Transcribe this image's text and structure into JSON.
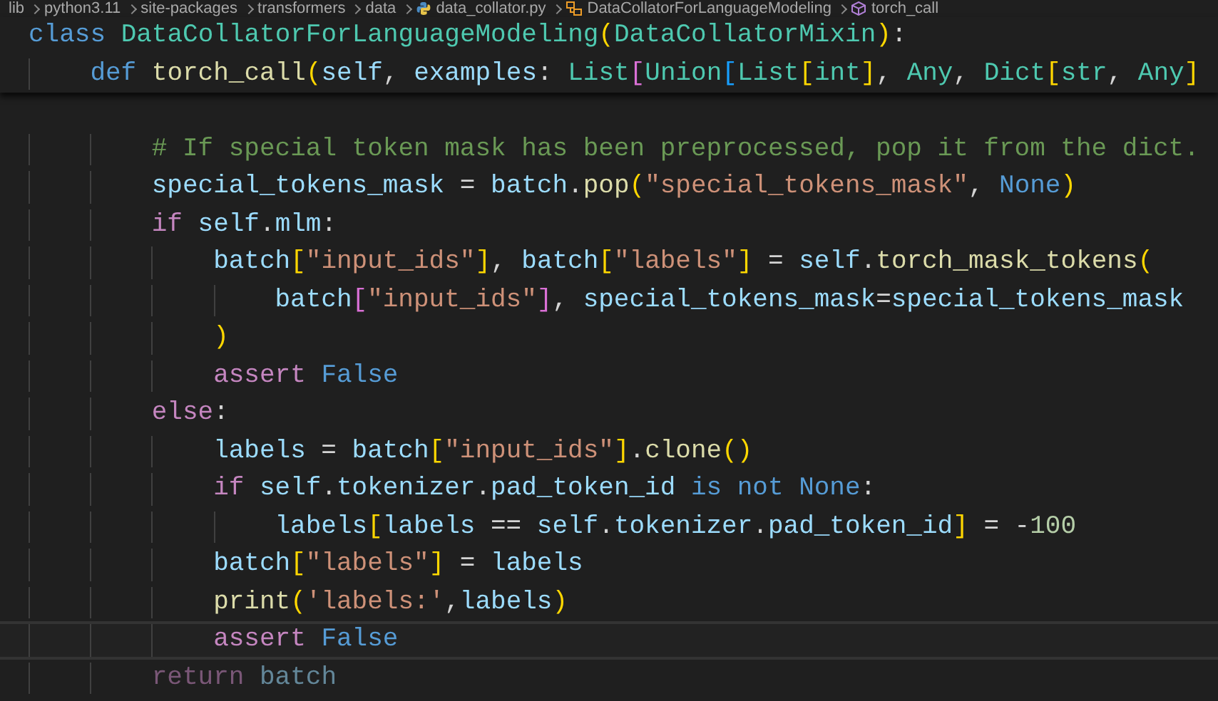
{
  "breadcrumb": [
    {
      "label": "lib",
      "kind": "folder"
    },
    {
      "label": "python3.11",
      "kind": "folder"
    },
    {
      "label": "site-packages",
      "kind": "folder"
    },
    {
      "label": "transformers",
      "kind": "folder"
    },
    {
      "label": "data",
      "kind": "folder"
    },
    {
      "label": "data_collator.py",
      "kind": "file"
    },
    {
      "label": "DataCollatorForLanguageModeling",
      "kind": "class"
    },
    {
      "label": "torch_call",
      "kind": "method"
    }
  ],
  "sticky_lines": [
    {
      "current": false,
      "dimmed": false,
      "tokens": [
        {
          "text": "class ",
          "kind": "kw"
        },
        {
          "text": "DataCollatorForLanguageModeling",
          "kind": "cls"
        },
        {
          "text": "(",
          "kind": "b1"
        },
        {
          "text": "DataCollatorMixin",
          "kind": "cls"
        },
        {
          "text": ")",
          "kind": "b1"
        },
        {
          "text": ":",
          "kind": "p"
        }
      ],
      "children": [
        {
          "current": false,
          "dimmed": false,
          "tokens": [
            {
              "text": "def ",
              "kind": "kw"
            },
            {
              "text": "torch_call",
              "kind": "fn"
            },
            {
              "text": "(",
              "kind": "b1"
            },
            {
              "text": "self",
              "kind": "var"
            },
            {
              "text": ", ",
              "kind": "p"
            },
            {
              "text": "examples",
              "kind": "var"
            },
            {
              "text": ": ",
              "kind": "p"
            },
            {
              "text": "List",
              "kind": "cls"
            },
            {
              "text": "[",
              "kind": "b2"
            },
            {
              "text": "Union",
              "kind": "cls"
            },
            {
              "text": "[",
              "kind": "b3"
            },
            {
              "text": "List",
              "kind": "cls"
            },
            {
              "text": "[",
              "kind": "b1"
            },
            {
              "text": "int",
              "kind": "cls"
            },
            {
              "text": "]",
              "kind": "b1"
            },
            {
              "text": ", ",
              "kind": "p"
            },
            {
              "text": "Any",
              "kind": "cls"
            },
            {
              "text": ", ",
              "kind": "p"
            },
            {
              "text": "Dict",
              "kind": "cls"
            },
            {
              "text": "[",
              "kind": "b1"
            },
            {
              "text": "str",
              "kind": "cls"
            },
            {
              "text": ", ",
              "kind": "p"
            },
            {
              "text": "Any",
              "kind": "cls"
            },
            {
              "text": "]",
              "kind": "b1"
            }
          ]
        }
      ]
    }
  ],
  "code_lines": [
    {
      "current": false,
      "dimmed": false,
      "tokens": [
        {
          "text": "# If special token mask has been preprocessed, pop it from the dict.",
          "kind": "cmt"
        }
      ]
    },
    {
      "current": false,
      "dimmed": false,
      "tokens": [
        {
          "text": "special_tokens_mask",
          "kind": "var"
        },
        {
          "text": " = ",
          "kind": "p"
        },
        {
          "text": "batch",
          "kind": "var"
        },
        {
          "text": ".",
          "kind": "p"
        },
        {
          "text": "pop",
          "kind": "fn"
        },
        {
          "text": "(",
          "kind": "b1"
        },
        {
          "text": "\"special_tokens_mask\"",
          "kind": "str"
        },
        {
          "text": ", ",
          "kind": "p"
        },
        {
          "text": "None",
          "kind": "kw"
        },
        {
          "text": ")",
          "kind": "b1"
        }
      ]
    },
    {
      "current": false,
      "dimmed": false,
      "tokens": [
        {
          "text": "if ",
          "kind": "ctl"
        },
        {
          "text": "self",
          "kind": "var"
        },
        {
          "text": ".",
          "kind": "p"
        },
        {
          "text": "mlm",
          "kind": "var"
        },
        {
          "text": ":",
          "kind": "p"
        }
      ],
      "children": [
        {
          "current": false,
          "dimmed": false,
          "tokens": [
            {
              "text": "batch",
              "kind": "var"
            },
            {
              "text": "[",
              "kind": "b1"
            },
            {
              "text": "\"input_ids\"",
              "kind": "str"
            },
            {
              "text": "]",
              "kind": "b1"
            },
            {
              "text": ", ",
              "kind": "p"
            },
            {
              "text": "batch",
              "kind": "var"
            },
            {
              "text": "[",
              "kind": "b1"
            },
            {
              "text": "\"labels\"",
              "kind": "str"
            },
            {
              "text": "]",
              "kind": "b1"
            },
            {
              "text": " = ",
              "kind": "p"
            },
            {
              "text": "self",
              "kind": "var"
            },
            {
              "text": ".",
              "kind": "p"
            },
            {
              "text": "torch_mask_tokens",
              "kind": "fn"
            },
            {
              "text": "(",
              "kind": "b1"
            }
          ],
          "children": [
            {
              "current": false,
              "dimmed": false,
              "tokens": [
                {
                  "text": "batch",
                  "kind": "var"
                },
                {
                  "text": "[",
                  "kind": "b2"
                },
                {
                  "text": "\"input_ids\"",
                  "kind": "str"
                },
                {
                  "text": "]",
                  "kind": "b2"
                },
                {
                  "text": ", ",
                  "kind": "p"
                },
                {
                  "text": "special_tokens_mask",
                  "kind": "var"
                },
                {
                  "text": "=",
                  "kind": "p"
                },
                {
                  "text": "special_tokens_mask",
                  "kind": "var"
                }
              ]
            }
          ]
        },
        {
          "current": false,
          "dimmed": false,
          "tokens": [
            {
              "text": ")",
              "kind": "b1"
            }
          ]
        },
        {
          "current": false,
          "dimmed": false,
          "tokens": [
            {
              "text": "assert ",
              "kind": "ctl"
            },
            {
              "text": "False",
              "kind": "kw"
            }
          ]
        }
      ]
    },
    {
      "current": false,
      "dimmed": false,
      "tokens": [
        {
          "text": "else",
          "kind": "ctl"
        },
        {
          "text": ":",
          "kind": "p"
        }
      ],
      "children": [
        {
          "current": false,
          "dimmed": false,
          "tokens": [
            {
              "text": "labels",
              "kind": "var"
            },
            {
              "text": " = ",
              "kind": "p"
            },
            {
              "text": "batch",
              "kind": "var"
            },
            {
              "text": "[",
              "kind": "b1"
            },
            {
              "text": "\"input_ids\"",
              "kind": "str"
            },
            {
              "text": "]",
              "kind": "b1"
            },
            {
              "text": ".",
              "kind": "p"
            },
            {
              "text": "clone",
              "kind": "fn"
            },
            {
              "text": "()",
              "kind": "b1"
            }
          ]
        },
        {
          "current": false,
          "dimmed": false,
          "tokens": [
            {
              "text": "if ",
              "kind": "ctl"
            },
            {
              "text": "self",
              "kind": "var"
            },
            {
              "text": ".",
              "kind": "p"
            },
            {
              "text": "tokenizer",
              "kind": "var"
            },
            {
              "text": ".",
              "kind": "p"
            },
            {
              "text": "pad_token_id ",
              "kind": "var"
            },
            {
              "text": "is not None",
              "kind": "kw"
            },
            {
              "text": ":",
              "kind": "p"
            }
          ],
          "children": [
            {
              "current": false,
              "dimmed": false,
              "tokens": [
                {
                  "text": "labels",
                  "kind": "var"
                },
                {
                  "text": "[",
                  "kind": "b1"
                },
                {
                  "text": "labels",
                  "kind": "var"
                },
                {
                  "text": " == ",
                  "kind": "p"
                },
                {
                  "text": "self",
                  "kind": "var"
                },
                {
                  "text": ".",
                  "kind": "p"
                },
                {
                  "text": "tokenizer",
                  "kind": "var"
                },
                {
                  "text": ".",
                  "kind": "p"
                },
                {
                  "text": "pad_token_id",
                  "kind": "var"
                },
                {
                  "text": "]",
                  "kind": "b1"
                },
                {
                  "text": " = -",
                  "kind": "p"
                },
                {
                  "text": "100",
                  "kind": "num"
                }
              ]
            }
          ]
        },
        {
          "current": false,
          "dimmed": false,
          "tokens": [
            {
              "text": "batch",
              "kind": "var"
            },
            {
              "text": "[",
              "kind": "b1"
            },
            {
              "text": "\"labels\"",
              "kind": "str"
            },
            {
              "text": "]",
              "kind": "b1"
            },
            {
              "text": " = ",
              "kind": "p"
            },
            {
              "text": "labels",
              "kind": "var"
            }
          ]
        },
        {
          "current": false,
          "dimmed": false,
          "tokens": [
            {
              "text": "print",
              "kind": "fn"
            },
            {
              "text": "(",
              "kind": "b1"
            },
            {
              "text": "'labels:'",
              "kind": "str"
            },
            {
              "text": ",",
              "kind": "p"
            },
            {
              "text": "labels",
              "kind": "var"
            },
            {
              "text": ")",
              "kind": "b1"
            }
          ]
        },
        {
          "current": true,
          "dimmed": false,
          "tokens": [
            {
              "text": "assert ",
              "kind": "ctl"
            },
            {
              "text": "False",
              "kind": "kw"
            }
          ]
        }
      ]
    },
    {
      "current": false,
      "dimmed": true,
      "tokens": [
        {
          "text": "return ",
          "kind": "ctl"
        },
        {
          "text": "batch",
          "kind": "var"
        }
      ]
    }
  ]
}
